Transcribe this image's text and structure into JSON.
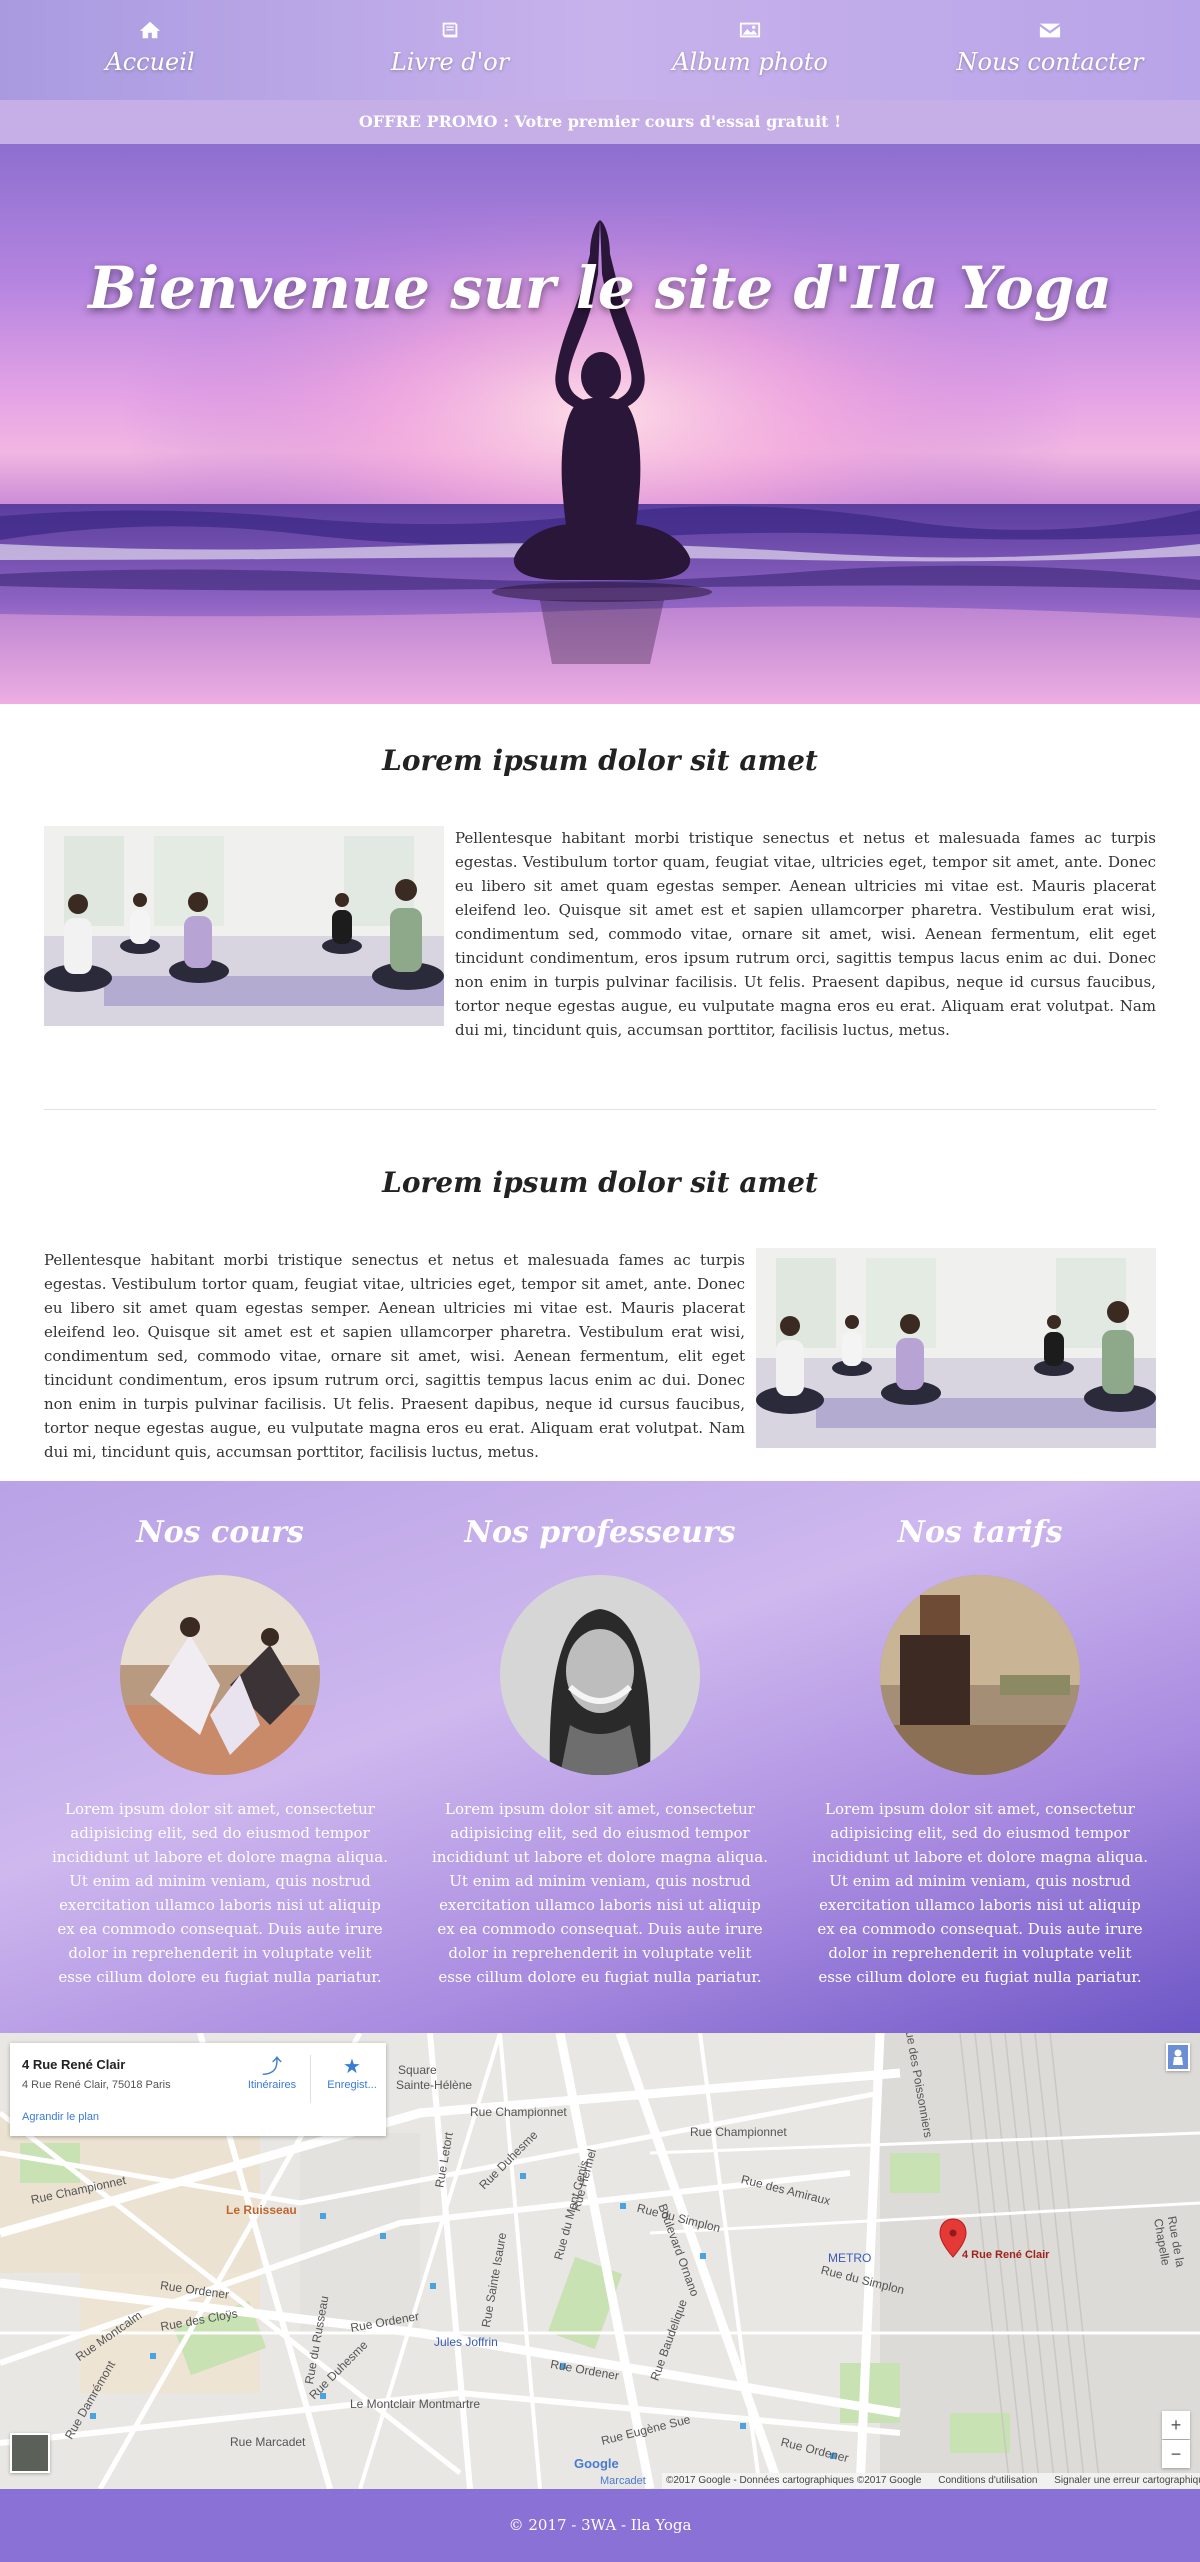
{
  "nav": {
    "items": [
      {
        "label": "Accueil",
        "icon": "home-icon"
      },
      {
        "label": "Livre d'or",
        "icon": "book-icon"
      },
      {
        "label": "Album photo",
        "icon": "picture-icon"
      },
      {
        "label": "Nous contacter",
        "icon": "envelope-icon"
      }
    ]
  },
  "promo": {
    "text": "OFFRE PROMO : Votre premier cours d'essai gratuit !"
  },
  "hero": {
    "title": "Bienvenue sur le site d'Ila Yoga"
  },
  "sections": [
    {
      "title": "Lorem ipsum dolor sit amet",
      "text": "Pellentesque habitant morbi tristique senectus et netus et malesuada fames ac turpis egestas. Vestibulum tortor quam, feugiat vitae, ultricies eget, tempor sit amet, ante. Donec eu libero sit amet quam egestas semper. Aenean ultricies mi vitae est. Mauris placerat eleifend leo. Quisque sit amet est et sapien ullamcorper pharetra. Vestibulum erat wisi, condimentum sed, commodo vitae, ornare sit amet, wisi. Aenean fermentum, elit eget tincidunt condimentum, eros ipsum rutrum orci, sagittis tempus lacus enim ac dui. Donec non enim in turpis pulvinar facilisis. Ut felis. Praesent dapibus, neque id cursus faucibus, tortor neque egestas augue, eu vulputate magna eros eu erat. Aliquam erat volutpat. Nam dui mi, tincidunt quis, accumsan porttitor, facilisis luctus, metus."
    },
    {
      "title": "Lorem ipsum dolor sit amet",
      "text": "Pellentesque habitant morbi tristique senectus et netus et malesuada fames ac turpis egestas. Vestibulum tortor quam, feugiat vitae, ultricies eget, tempor sit amet, ante. Donec eu libero sit amet quam egestas semper. Aenean ultricies mi vitae est. Mauris placerat eleifend leo. Quisque sit amet est et sapien ullamcorper pharetra. Vestibulum erat wisi, condimentum sed, commodo vitae, ornare sit amet, wisi. Aenean fermentum, elit eget tincidunt condimentum, eros ipsum rutrum orci, sagittis tempus lacus enim ac dui. Donec non enim in turpis pulvinar facilisis. Ut felis. Praesent dapibus, neque id cursus faucibus, tortor neque egestas augue, eu vulputate magna eros eu erat. Aliquam erat volutpat. Nam dui mi, tincidunt quis, accumsan porttitor, facilisis luctus, metus."
    }
  ],
  "features": [
    {
      "title": "Nos cours",
      "text": "Lorem ipsum dolor sit amet, consectetur adipisicing elit, sed do eiusmod tempor incididunt ut labore et dolore magna aliqua. Ut enim ad minim veniam, quis nostrud exercitation ullamco laboris nisi ut aliquip ex ea commodo consequat. Duis aute irure dolor in reprehenderit in voluptate velit esse cillum dolore eu fugiat nulla pariatur."
    },
    {
      "title": "Nos professeurs",
      "text": "Lorem ipsum dolor sit amet, consectetur adipisicing elit, sed do eiusmod tempor incididunt ut labore et dolore magna aliqua. Ut enim ad minim veniam, quis nostrud exercitation ullamco laboris nisi ut aliquip ex ea commodo consequat. Duis aute irure dolor in reprehenderit in voluptate velit esse cillum dolore eu fugiat nulla pariatur."
    },
    {
      "title": "Nos tarifs",
      "text": "Lorem ipsum dolor sit amet, consectetur adipisicing elit, sed do eiusmod tempor incididunt ut labore et dolore magna aliqua. Ut enim ad minim veniam, quis nostrud exercitation ullamco laboris nisi ut aliquip ex ea commodo consequat. Duis aute irure dolor in reprehenderit in voluptate velit esse cillum dolore eu fugiat nulla pariatur."
    }
  ],
  "map": {
    "card": {
      "title": "4 Rue René Clair",
      "address": "4 Rue René Clair, 75018 Paris",
      "link": "Agrandir le plan",
      "directions": "Itinéraires",
      "save": "Enregist..."
    },
    "marker_label": "4 Rue René Clair",
    "labels": {
      "square": "Square",
      "sainte_helene": "Sainte-Hélène",
      "championnet_1": "Rue Championnet",
      "championnet_2": "Rue Championnet",
      "championnet_3": "Rue Championnet",
      "amiraux": "Rue des Amiraux",
      "simplon_1": "Rue du Simplon",
      "simplon_2": "Rue du Simplon",
      "ruisseau": "Le Ruisseau",
      "metro": "METRO",
      "ordener_1": "Rue Ordener",
      "ordener_2": "Rue Ordener",
      "ordener_3": "Rue Ordener",
      "ordener_4": "Rue Ordener",
      "cloys": "Rue des Cloÿs",
      "montcalm": "Rue Montcalm",
      "damremont": "Rue Damrémont",
      "duhesme_1": "Rue Duhesme",
      "duhesme_2": "Rue Duhesme",
      "jules_joffrin": "Jules Joffrin",
      "montclair": "Le Montclair Montmartre",
      "marcadet_street": "Rue Marcadet",
      "eugene_sue": "Rue Eugène Sue",
      "boulevard_ornano": "Boulevard Ornano",
      "poissonniers": "Rue des Poissonniers",
      "mont_cenis": "Rue du Mont Cenis",
      "letort": "Rue Letort",
      "hermel": "Rue Hermel",
      "baudelique": "Rue Baudelique",
      "sainte_isaure": "Rue Sainte Isaure",
      "russeau": "Rue du Russeau",
      "labat": "Rue de la Chapelle"
    },
    "google": "Google",
    "marcadet": "Marcadet",
    "attribution": [
      "©2017 Google - Données cartographiques ©2017 Google",
      "Conditions d'utilisation",
      "Signaler une erreur cartographique"
    ],
    "zoom_in": "+",
    "zoom_out": "−"
  },
  "footer": {
    "text": "© 2017 - 3WA - Ila Yoga"
  },
  "colors": {
    "nav": "#b8a4e8",
    "promo": "#c6aee6",
    "footer": "#8a71d6",
    "marker": "#e53935"
  }
}
